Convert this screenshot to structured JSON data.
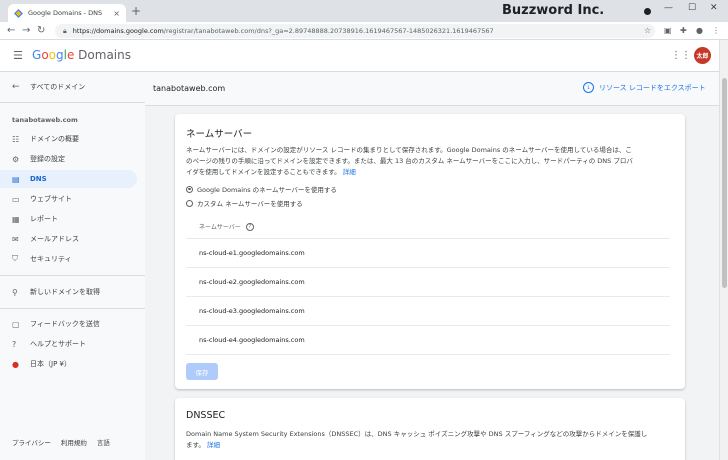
{
  "browser": {
    "tab_title": "Google Domains - DNS",
    "tab_close": "×",
    "new_tab": "+",
    "brand": "Buzzword Inc.",
    "url_host": "https://domains.google.com",
    "url_path": "/registrar/tanabotaweb.com/dns?_ga=2.89748888.20738916.1619467567-1485026321.1619467567",
    "win_min": "—",
    "win_max": "☐",
    "win_close": "✕"
  },
  "app": {
    "logo_g": "G",
    "logo_o1": "o",
    "logo_o2": "o",
    "logo_g2": "g",
    "logo_l": "l",
    "logo_e": "e",
    "logo_suffix": " Domains",
    "avatar": "太郎"
  },
  "sidebar": {
    "back": "すべてのドメイン",
    "domain": "tanabotaweb.com",
    "items": [
      {
        "label": "ドメインの概要",
        "icon": "list-icon"
      },
      {
        "label": "登録の設定",
        "icon": "gear-icon"
      },
      {
        "label": "DNS",
        "icon": "dns-icon"
      },
      {
        "label": "ウェブサイト",
        "icon": "web-icon"
      },
      {
        "label": "レポート",
        "icon": "report-icon"
      },
      {
        "label": "メールアドレス",
        "icon": "mail-icon"
      },
      {
        "label": "セキュリティ",
        "icon": "shield-icon"
      }
    ],
    "new_domain": "新しいドメインを取得",
    "feedback": "フィードバックを送信",
    "help": "ヘルプとサポート",
    "region": "日本（JP ¥）",
    "footer": [
      "プライバシー",
      "利用規約",
      "言語"
    ]
  },
  "main": {
    "domain": "tanabotaweb.com",
    "export": "リソース レコードをエクスポート",
    "nameserver_card": {
      "title": "ネームサーバー",
      "description_1": "ネームサーバーには、ドメインの設定がリソース レコードの集まりとして保存されます。Google Domains のネームサーバーを使用している場合は、こ",
      "description_2": "のページの残りの手順に沿ってドメインを設定できます。または、最大 13 台のカスタム ネームサーバーをここに入力し、サードパーティの DNS プロバ",
      "description_3": "イダを使用してドメインを設定することもできます。",
      "details_link": "詳細",
      "option_google": "Google Domains のネームサーバーを使用する",
      "option_custom": "カスタム ネームサーバーを使用する",
      "ns_header": "ネームサーバー",
      "nameservers": [
        "ns-cloud-e1.googledomains.com",
        "ns-cloud-e2.googledomains.com",
        "ns-cloud-e3.googledomains.com",
        "ns-cloud-e4.googledomains.com"
      ],
      "save": "保存"
    },
    "dnssec_card": {
      "title": "DNSSEC",
      "description_1": "Domain Name System Security Extensions（DNSSEC）は、DNS キャッシュ ポイズニング攻撃や DNS スプーフィングなどの攻撃からドメインを保護し",
      "description_2": "ます。",
      "details_link": "詳細"
    }
  }
}
